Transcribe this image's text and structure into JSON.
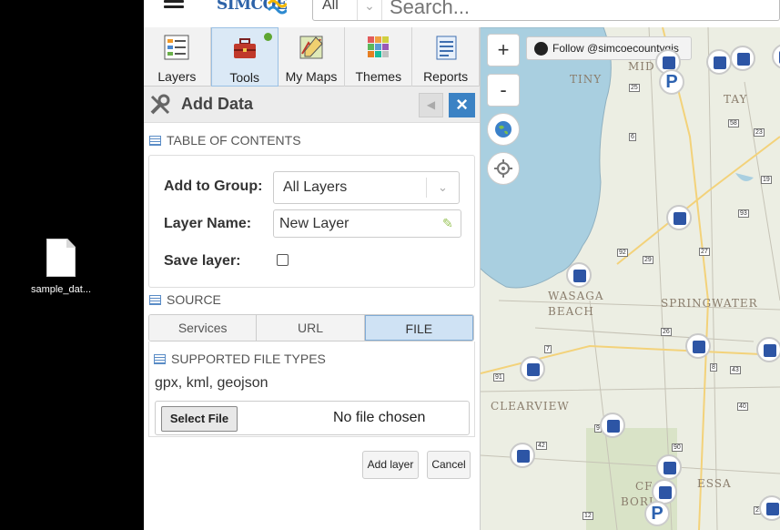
{
  "desktop": {
    "file_label": "sample_dat..."
  },
  "appbar": {
    "logo_text": "SIMCOE",
    "search_scope": "All",
    "search_placeholder": "Search..."
  },
  "nav": {
    "tabs": [
      {
        "label": "Layers",
        "icon": "layers-icon"
      },
      {
        "label": "Tools",
        "icon": "toolbox-icon",
        "active": true
      },
      {
        "label": "My Maps",
        "icon": "mymaps-icon"
      },
      {
        "label": "Themes",
        "icon": "themes-icon"
      },
      {
        "label": "Reports",
        "icon": "reports-icon"
      }
    ]
  },
  "tool": {
    "title": "Add Data",
    "toc_heading": "TABLE OF CONTENTS",
    "add_to_group_label": "Add to Group:",
    "add_to_group_value": "All Layers",
    "layer_name_label": "Layer Name:",
    "layer_name_value": "New Layer",
    "save_layer_label": "Save layer:",
    "source_heading": "SOURCE",
    "source_tabs": [
      "Services",
      "URL",
      "FILE"
    ],
    "supported_heading": "SUPPORTED FILE TYPES",
    "supported_types": "gpx, kml, geojson",
    "select_file_label": "Select File",
    "file_status": "No file chosen",
    "add_layer_label": "Add layer",
    "cancel_label": "Cancel"
  },
  "map": {
    "zoom_in": "+",
    "zoom_out": "-",
    "follow_label": "Follow @simcoecountygis",
    "places": [
      "TINY",
      "TAY",
      "WASAGA",
      "BEACH",
      "SPRINGWATER",
      "CLEARVIEW",
      "ESSA",
      "MID",
      "CF",
      "BORI"
    ],
    "roads": [
      "25",
      "6",
      "58",
      "23",
      "19",
      "93",
      "92",
      "29",
      "27",
      "26",
      "7",
      "91",
      "8",
      "43",
      "42",
      "9",
      "40",
      "90",
      "12",
      "2"
    ]
  },
  "colors": {
    "accent": "#3b82c4",
    "lake": "#a9cfe0"
  }
}
